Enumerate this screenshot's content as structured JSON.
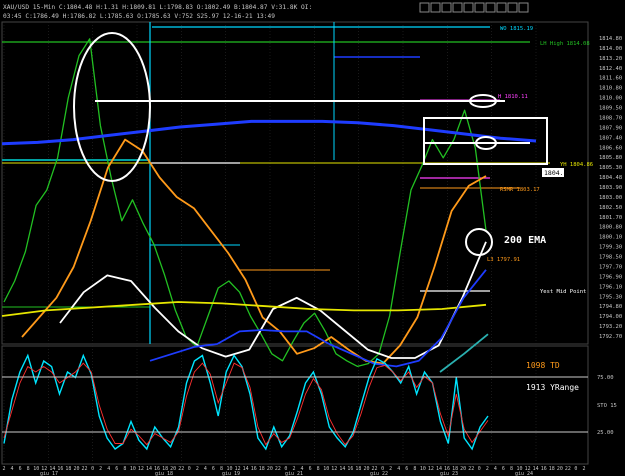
{
  "header": {
    "line1": "XAU/USD  15-Min  C:1804.48  H:1.31  H:1809.81  L:1798.83  O:1802.49  B:1804.87  V:31.8K  OI:",
    "line2": "03:45  C:1786.49  H:1786.82  L:1785.63  O:1785.63  V:752  S25.97  12-16-21  13:49"
  },
  "colors": {
    "background": "#000000",
    "grid": "#2a2a2a",
    "axis_text": "#c8c8c8",
    "blue_ema": "#1e3cff",
    "yellow": "#e6e600",
    "white": "#ffffff",
    "orange": "#ff9a1a",
    "red": "#ff2a2a",
    "green": "#22c022",
    "cyan": "#00d8ff",
    "teal": "#2ab0b0",
    "magenta": "#ff40ff",
    "stoch_fast": "#00e5ff",
    "stoch_slow": "#ff3030"
  },
  "annotations": {
    "ema_label": "200 EMA",
    "td_label": "1098 TD",
    "yrange_label": "1913 YRange"
  },
  "level_labels": [
    {
      "text": "WO 1815.19",
      "color": "#00d8ff"
    },
    {
      "text": "LH High 1814.08",
      "color": "#22c022"
    },
    {
      "text": "YH 1804.86",
      "color": "#e6e600"
    },
    {
      "text": "RSMR 1803.17",
      "color": "#ff9a1a"
    },
    {
      "text": "L3 1797.91",
      "color": "#ff9a1a"
    },
    {
      "text": "Yest Mid Point",
      "color": "#ffffff"
    },
    {
      "text": "H 1810.11",
      "color": "#ff40ff"
    }
  ],
  "chart_data": [
    {
      "type": "line",
      "panel": "price",
      "ylim": [
        1792.0,
        1815.0
      ],
      "y_ticks": [
        "1814.80",
        "1814.00",
        "1813.20",
        "1812.40",
        "1811.60",
        "1810.80",
        "1810.00",
        "1809.50",
        "1808.70",
        "1807.90",
        "1807.40",
        "1806.60",
        "1805.80",
        "1805.30",
        "1804.48",
        "1803.90",
        "1803.00",
        "1802.50",
        "1801.70",
        "1800.80",
        "1800.10",
        "1799.30",
        "1798.50",
        "1797.70",
        "1796.90",
        "1796.10",
        "1795.30",
        "1794.80",
        "1794.00",
        "1793.20",
        "1792.70"
      ],
      "last_price": "1804.48",
      "x_tick_labels": [
        "2",
        "4",
        "6",
        "8",
        "10",
        "12",
        "14",
        "16",
        "18",
        "20",
        "22",
        "0",
        "2",
        "4",
        "6",
        "8",
        "10",
        "12",
        "14",
        "16",
        "18",
        "20",
        "22",
        "0",
        "2",
        "4",
        "6",
        "8",
        "10",
        "12",
        "14",
        "16",
        "18",
        "20",
        "22",
        "0",
        "2",
        "4",
        "6",
        "8",
        "10",
        "12",
        "14",
        "16",
        "18",
        "20",
        "22",
        "0",
        "2",
        "4",
        "6",
        "8",
        "10",
        "12",
        "14",
        "16",
        "18",
        "20",
        "22",
        "0",
        "2",
        "4",
        "6",
        "8",
        "10",
        "12",
        "14",
        "16",
        "18",
        "20",
        "22",
        "0",
        "2"
      ],
      "x_date_labels": [
        "giu 17",
        "giu 18",
        "giu 19",
        "giu 21",
        "giu 22",
        "giu 23",
        "giu 24"
      ],
      "series": [
        {
          "role": "price",
          "color": "#22c022",
          "values": [
            1795.0,
            1796.5,
            1798.6,
            1801.9,
            1803.0,
            1805.3,
            1809.6,
            1812.6,
            1813.8,
            1807.6,
            1803.9,
            1800.8,
            1802.3,
            1800.6,
            1799.1,
            1796.9,
            1794.4,
            1792.5,
            1791.8,
            1793.9,
            1796.0,
            1796.5,
            1795.7,
            1794.0,
            1792.7,
            1791.3,
            1790.8,
            1792.2,
            1793.5,
            1794.2,
            1792.9,
            1791.3,
            1790.8,
            1790.4,
            1790.6,
            1791.3,
            1794.0,
            1798.6,
            1803.0,
            1804.7,
            1806.6,
            1805.3,
            1806.6,
            1808.7,
            1806.0,
            1800.1
          ]
        },
        {
          "role": "200 EMA",
          "color": "#1e3cff",
          "values": [
            1806.3,
            1806.4,
            1806.6,
            1806.9,
            1807.2,
            1807.5,
            1807.7,
            1807.9,
            1807.9,
            1807.9,
            1807.8,
            1807.6,
            1807.3,
            1807.0,
            1806.7,
            1806.5
          ]
        },
        {
          "role": "orange-ema",
          "color": "#ff9a1a",
          "values": [
            1792.5,
            1793.9,
            1795.3,
            1797.5,
            1800.8,
            1804.6,
            1806.6,
            1805.8,
            1803.9,
            1802.5,
            1801.7,
            1800.1,
            1798.5,
            1796.6,
            1793.9,
            1792.9,
            1791.3,
            1791.7,
            1792.5,
            1791.6,
            1790.8,
            1790.6,
            1791.9,
            1793.9,
            1797.5,
            1801.5,
            1803.3,
            1804.0
          ]
        },
        {
          "role": "white-ma",
          "color": "#ffffff",
          "values": [
            1793.5,
            1795.7,
            1796.9,
            1796.5,
            1794.6,
            1792.9,
            1791.7,
            1791.1,
            1791.6,
            1794.5,
            1795.3,
            1794.4,
            1793.0,
            1791.6,
            1791.0,
            1791.0,
            1791.9,
            1795.3,
            1799.3
          ]
        },
        {
          "role": "yellow-ma",
          "color": "#e6e600",
          "values": [
            1794.0,
            1794.4,
            1794.6,
            1794.8,
            1795.0,
            1794.9,
            1794.7,
            1794.5,
            1794.4,
            1794.4,
            1794.5,
            1794.8
          ]
        },
        {
          "role": "blue-low",
          "color": "#1e3cff",
          "values": [
            1790.8,
            1791.3,
            1791.8,
            1792.0,
            1792.9,
            1793.0,
            1792.9,
            1792.9,
            1792.0,
            1791.3,
            1790.6,
            1790.4,
            1790.8,
            1792.4,
            1795.3,
            1797.3
          ]
        },
        {
          "role": "teal",
          "color": "#2ab0b0",
          "values": [
            1790.0,
            1791.3,
            1792.7
          ]
        }
      ]
    },
    {
      "type": "line",
      "panel": "stochastic",
      "ylim": [
        0,
        100
      ],
      "y_ticks": [
        "75.00",
        "STO 15",
        "25.00"
      ],
      "series": [
        {
          "role": "fast",
          "color": "#00e5ff",
          "values": [
            15,
            55,
            80,
            95,
            70,
            90,
            85,
            60,
            80,
            75,
            95,
            78,
            40,
            20,
            10,
            15,
            35,
            18,
            10,
            30,
            20,
            12,
            30,
            70,
            90,
            95,
            70,
            40,
            80,
            95,
            85,
            60,
            20,
            10,
            30,
            12,
            22,
            45,
            70,
            80,
            60,
            30,
            20,
            12,
            25,
            50,
            75,
            92,
            88,
            80,
            70,
            85,
            60,
            80,
            70,
            35,
            15,
            75,
            20,
            10,
            30,
            40
          ]
        },
        {
          "role": "slow",
          "color": "#ff3030",
          "values": [
            20,
            45,
            70,
            85,
            80,
            85,
            80,
            70,
            75,
            80,
            88,
            80,
            50,
            28,
            15,
            15,
            28,
            22,
            14,
            24,
            20,
            16,
            26,
            58,
            80,
            88,
            78,
            52,
            70,
            88,
            84,
            66,
            30,
            14,
            24,
            16,
            20,
            38,
            60,
            74,
            64,
            38,
            24,
            14,
            22,
            42,
            66,
            84,
            86,
            80,
            72,
            80,
            66,
            76,
            70,
            42,
            22,
            60,
            28,
            16,
            26,
            36
          ]
        }
      ]
    }
  ]
}
